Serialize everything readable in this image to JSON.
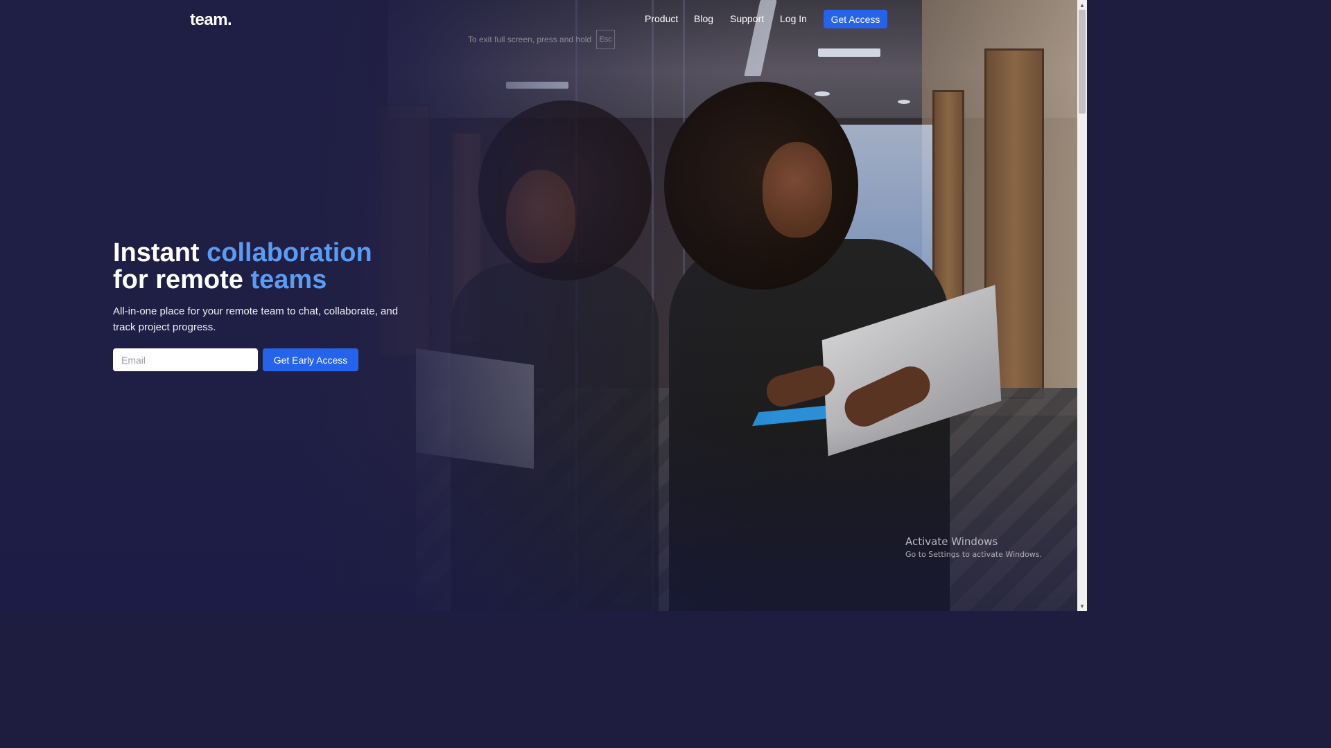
{
  "header": {
    "logo": "team.",
    "nav": [
      "Product",
      "Blog",
      "Support",
      "Log In"
    ],
    "cta_label": "Get Access"
  },
  "fullscreen_hint": {
    "text": "To exit full screen, press and hold",
    "key": "Esc"
  },
  "hero": {
    "headline_part1": "Instant ",
    "headline_accent1": "collaboration",
    "headline_part2": "for remote ",
    "headline_accent2": "teams",
    "subtitle": "All-in-one place for your remote team to chat, collaborate, and track project progress.",
    "email_placeholder": "Email",
    "cta_label": "Get Early Access"
  },
  "watermark": {
    "title": "Activate Windows",
    "subtitle": "Go to Settings to activate Windows."
  },
  "colors": {
    "accent_blue": "#2563eb",
    "headline_accent": "#5b9cf2",
    "overlay": "#1f1e45"
  }
}
